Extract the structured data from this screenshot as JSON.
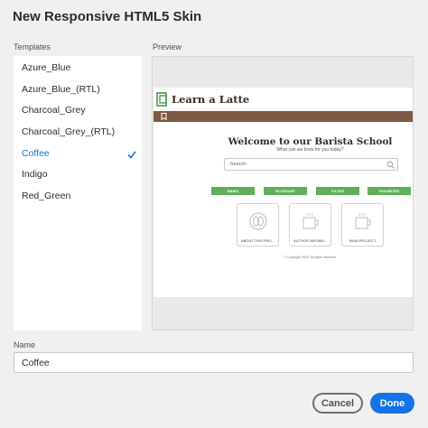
{
  "dialog": {
    "title": "New Responsive HTML5 Skin"
  },
  "templates": {
    "label": "Templates",
    "items": [
      {
        "label": "Azure_Blue",
        "selected": false
      },
      {
        "label": "Azure_Blue_(RTL)",
        "selected": false
      },
      {
        "label": "Charcoal_Grey",
        "selected": false
      },
      {
        "label": "Charcoal_Grey_(RTL)",
        "selected": false
      },
      {
        "label": "Coffee",
        "selected": true
      },
      {
        "label": "Indigo",
        "selected": false
      },
      {
        "label": "Red_Green",
        "selected": false
      }
    ],
    "selected_icon": "checkmark-icon",
    "selected_color": "#1473e6"
  },
  "preview": {
    "label": "Preview",
    "course_title": "Learn a Latte",
    "logo_icon": "book-logo-icon",
    "toolbar_icon": "bookmark-icon",
    "toolbar_color": "#7d5a46",
    "welcome_title": "Welcome to our Barista School",
    "subtitle": "What can we brew for you today?",
    "search_placeholder": "-Search-",
    "nav_color": "#5fae5a",
    "nav_buttons": [
      "INDEX",
      "GLOSSARY",
      "FILTER",
      "FAVORITES"
    ],
    "cards": [
      {
        "label": "ABOUT THIS PRO...",
        "icon": "coffee-bean-icon"
      },
      {
        "label": "AUTHOR INFORM...",
        "icon": "coffee-cup-icon"
      },
      {
        "label": "MAIN PROJECT",
        "icon": "coffee-cup-icon"
      }
    ],
    "copyright": "© Copyright 2015. All rights reserved."
  },
  "name": {
    "label": "Name",
    "value": "Coffee"
  },
  "buttons": {
    "cancel": "Cancel",
    "done": "Done",
    "primary_color": "#1473e6"
  }
}
